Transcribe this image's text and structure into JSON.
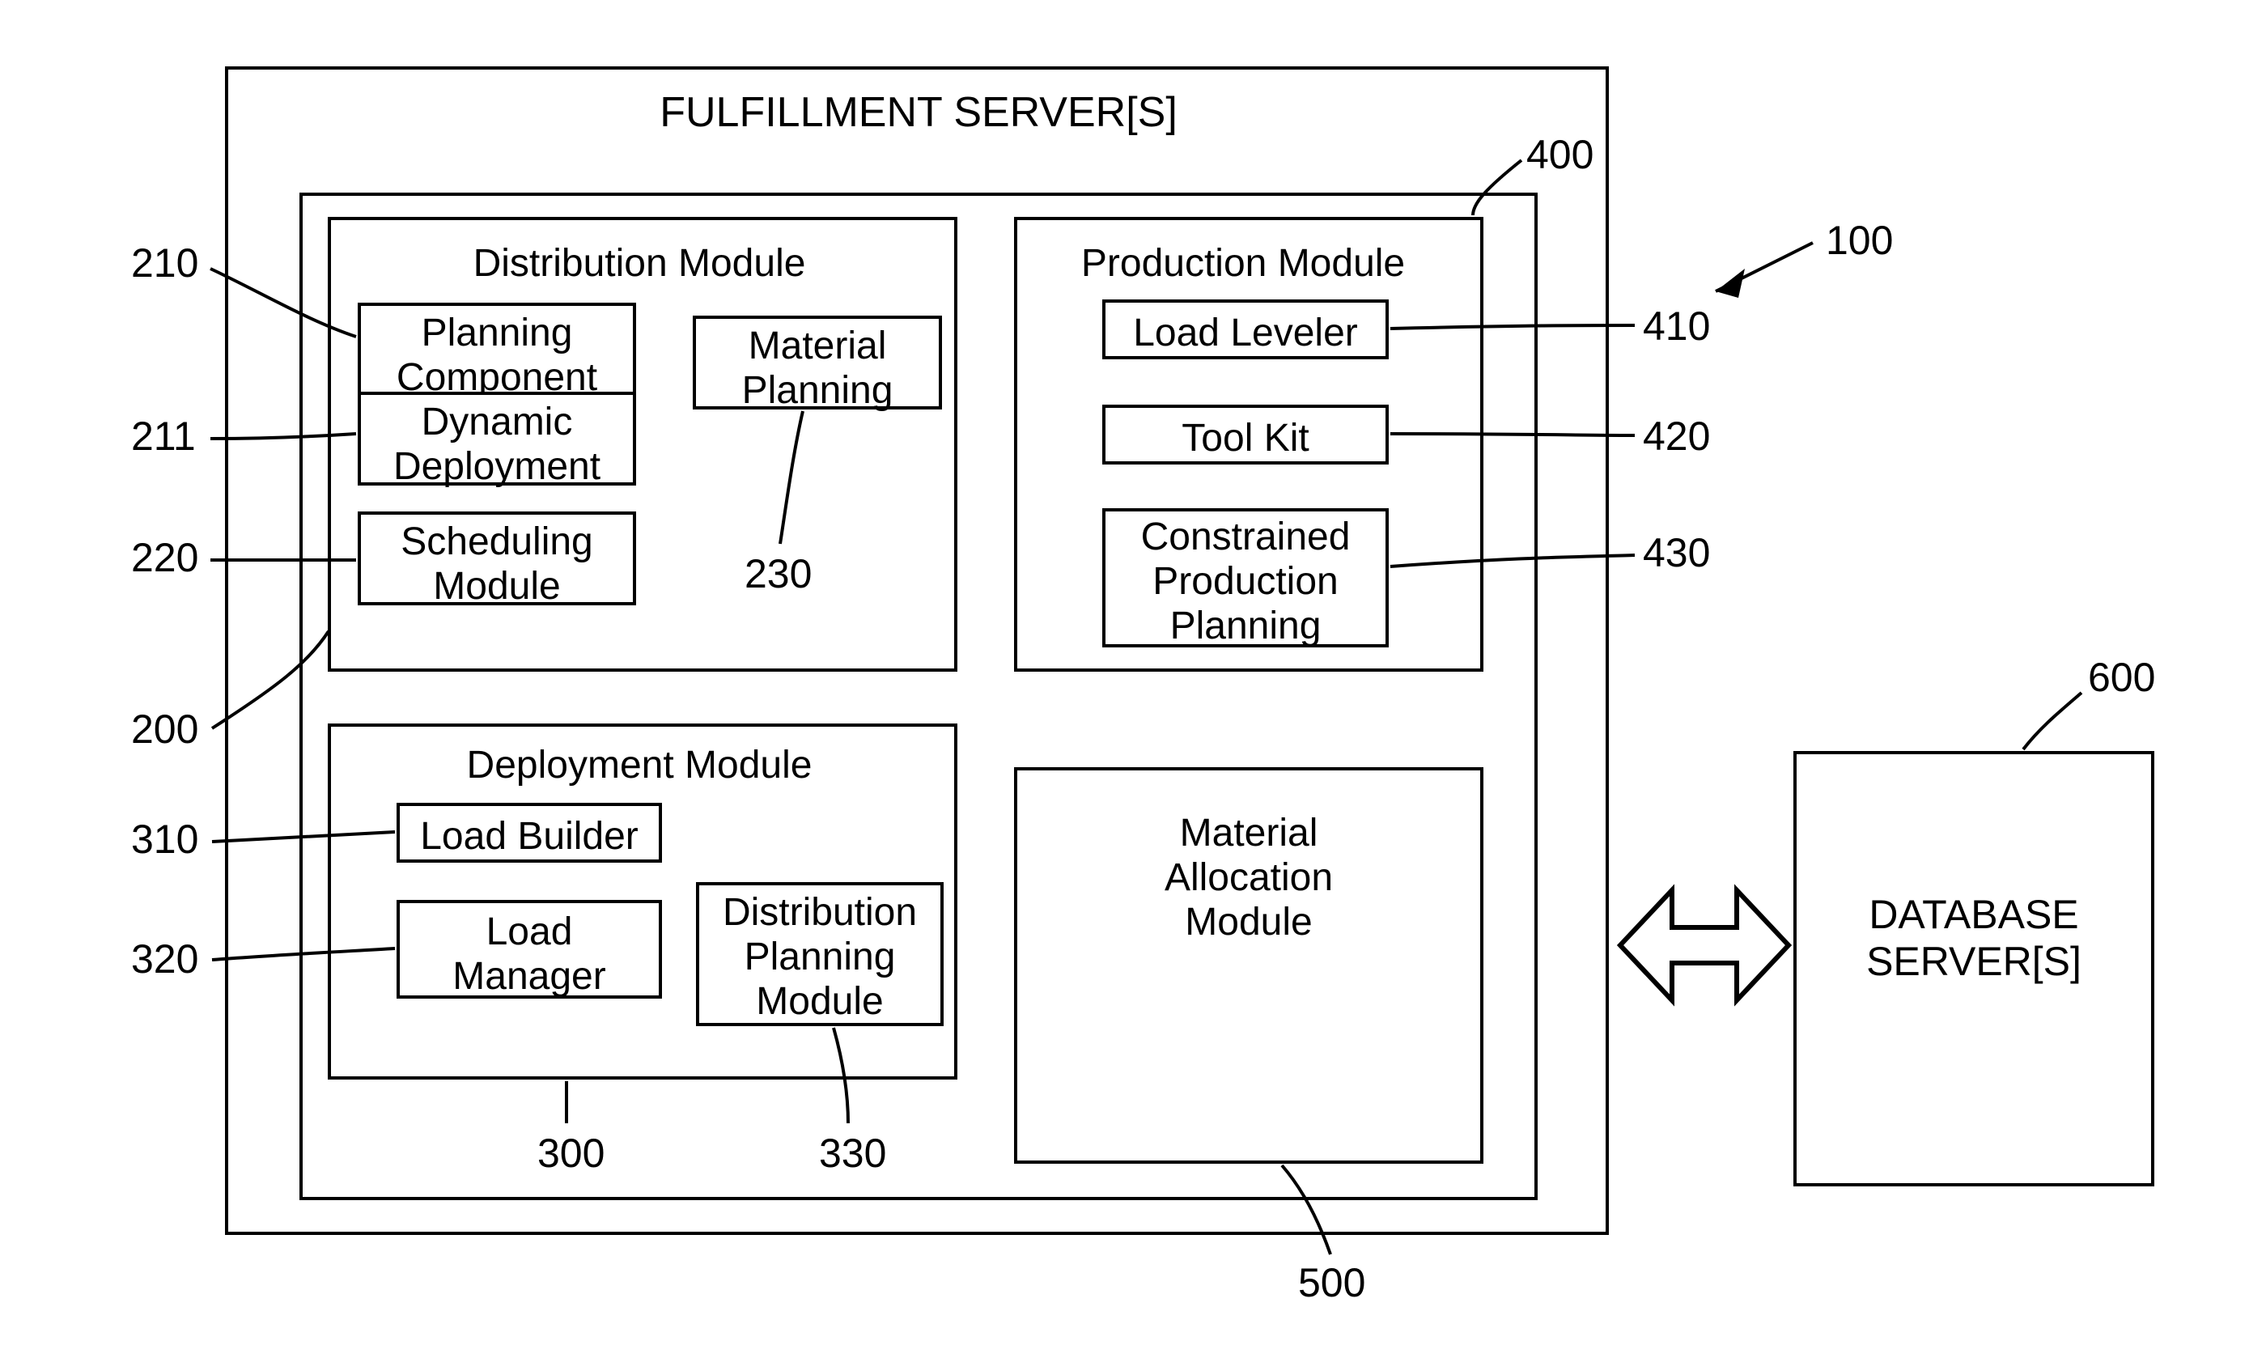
{
  "title": "FULFILLMENT SERVER[S]",
  "modules": {
    "distribution": {
      "title": "Distribution Module",
      "planning": "Planning\nComponent",
      "dynamic": "Dynamic\nDeployment",
      "scheduling": "Scheduling\nModule",
      "material": "Material\nPlanning"
    },
    "production": {
      "title": "Production Module",
      "load_leveler": "Load Leveler",
      "tool_kit": "Tool Kit",
      "constrained": "Constrained\nProduction\nPlanning"
    },
    "deployment": {
      "title": "Deployment Module",
      "load_builder": "Load Builder",
      "load_manager": "Load\nManager",
      "dist_planning": "Distribution\nPlanning\nModule"
    },
    "material_alloc": "Material\nAllocation\nModule",
    "database": "DATABASE\nSERVER[S]"
  },
  "refs": {
    "r100": "100",
    "r200": "200",
    "r210": "210",
    "r211": "211",
    "r220": "220",
    "r230": "230",
    "r300": "300",
    "r310": "310",
    "r320": "320",
    "r330": "330",
    "r400": "400",
    "r410": "410",
    "r420": "420",
    "r430": "430",
    "r500": "500",
    "r600": "600"
  }
}
